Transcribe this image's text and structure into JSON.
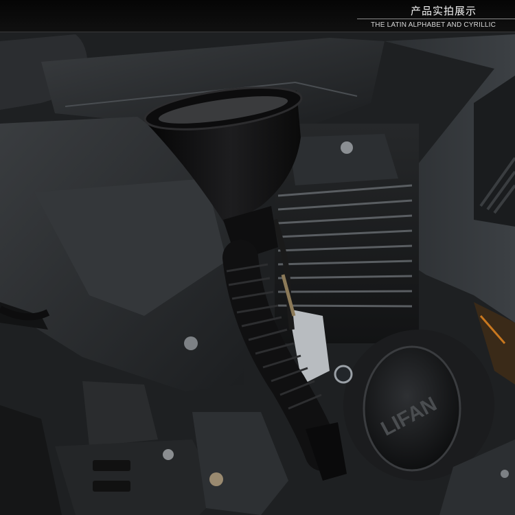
{
  "banner": {
    "title": "产品实拍展示",
    "subtitle": "THE LATIN ALPHABET AND CYRILLIC"
  },
  "engine_cover": {
    "brand": "LIFAN"
  },
  "colors": {
    "funnel": "#101010",
    "fairing": "#2e3134",
    "accent": "#c9781f"
  }
}
